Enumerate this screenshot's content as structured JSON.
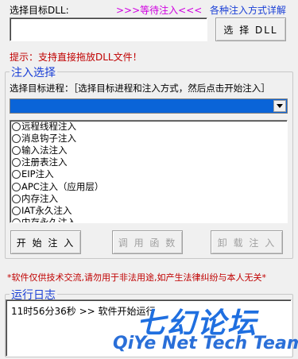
{
  "top": {
    "dll_label": "选择目标DLL:",
    "status": ">>>等待注入<<<",
    "methods_link": "各种注入方式详解",
    "dll_path_value": "",
    "select_dll_button": "选 择 DLL"
  },
  "tip": "提示：支持直接拖放DLL文件！",
  "inject_group": {
    "title": "注入选择",
    "process_label": "选择目标进程：［选择目标进程和注入方式，然后点击开始注入］",
    "process_selected": "",
    "methods": [
      "远程线程注入",
      "消息钩子注入",
      "输入法注入",
      "注册表注入",
      "EIP注入",
      "APC注入（应用层）",
      "内存注入",
      "IAT永久注入",
      "内存永久注入"
    ],
    "start_button": "开 始 注 入",
    "call_button": "调 用 函 数",
    "unload_button": "卸 载 注 入"
  },
  "warning": "*软件仅供技术交流,请勿用于非法用途,如产生法律纠纷与本人无关*",
  "log_group": {
    "title": "运行日志",
    "lines": [
      "11时56分36秒 >> 软件开始运行"
    ]
  },
  "watermark": {
    "cn": "七幻论坛",
    "en": "QiYe Net Tech Team"
  },
  "colors": {
    "accent_blue": "#1a3fd6",
    "status_magenta": "#d000e0",
    "tip_red": "#c00000",
    "selection_blue": "#0a64d8"
  },
  "icons": {
    "combo_arrow": "chevron-down-icon",
    "radio": "radio-button-icon"
  }
}
